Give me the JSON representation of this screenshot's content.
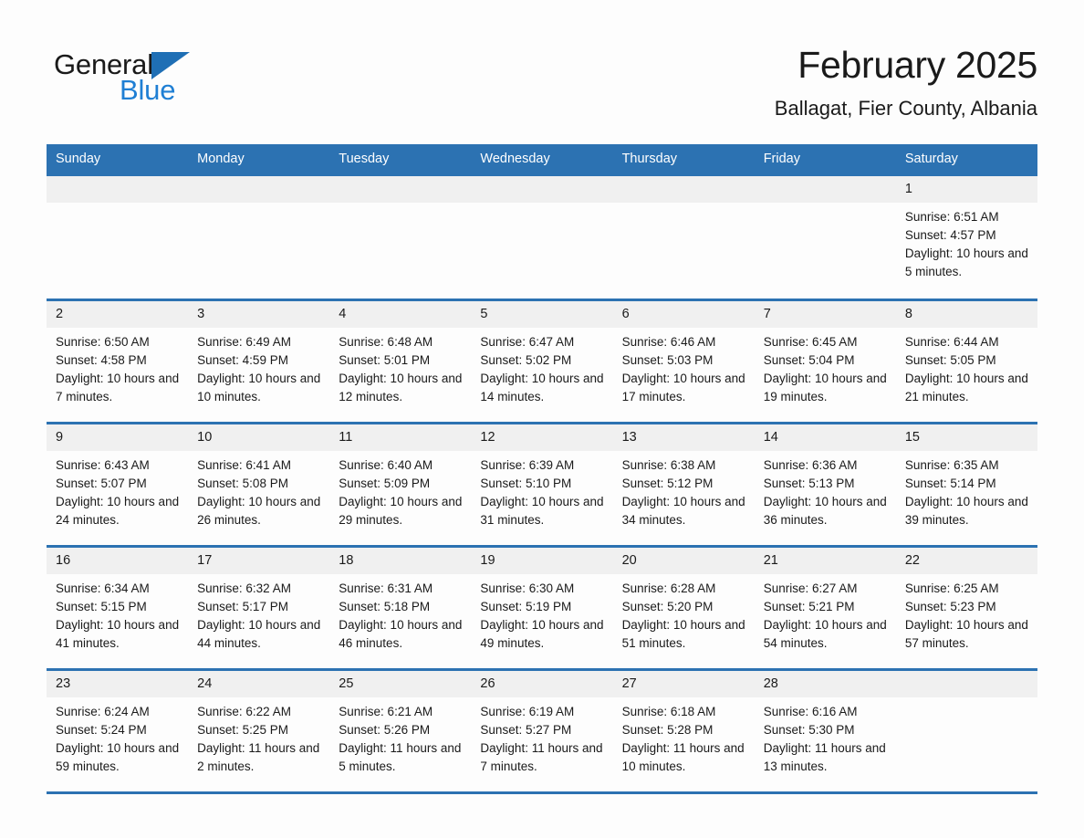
{
  "brand": {
    "name_part1": "General",
    "name_part2": "Blue",
    "triangle_color": "#1f6fb5",
    "blue_text_color": "#1f7fd4"
  },
  "header": {
    "month_title": "February 2025",
    "location": "Ballagat, Fier County, Albania"
  },
  "theme": {
    "header_blue": "#2c72b2",
    "daynum_band": "#f0f0f0",
    "page_background": "#fdfdfd",
    "text_color": "#1a1a1a"
  },
  "calendar": {
    "weekday_headers": [
      "Sunday",
      "Monday",
      "Tuesday",
      "Wednesday",
      "Thursday",
      "Friday",
      "Saturday"
    ],
    "weeks": [
      [
        {
          "day": "",
          "sunrise": "",
          "sunset": "",
          "daylight": ""
        },
        {
          "day": "",
          "sunrise": "",
          "sunset": "",
          "daylight": ""
        },
        {
          "day": "",
          "sunrise": "",
          "sunset": "",
          "daylight": ""
        },
        {
          "day": "",
          "sunrise": "",
          "sunset": "",
          "daylight": ""
        },
        {
          "day": "",
          "sunrise": "",
          "sunset": "",
          "daylight": ""
        },
        {
          "day": "",
          "sunrise": "",
          "sunset": "",
          "daylight": ""
        },
        {
          "day": "1",
          "sunrise": "Sunrise: 6:51 AM",
          "sunset": "Sunset: 4:57 PM",
          "daylight": "Daylight: 10 hours and 5 minutes."
        }
      ],
      [
        {
          "day": "2",
          "sunrise": "Sunrise: 6:50 AM",
          "sunset": "Sunset: 4:58 PM",
          "daylight": "Daylight: 10 hours and 7 minutes."
        },
        {
          "day": "3",
          "sunrise": "Sunrise: 6:49 AM",
          "sunset": "Sunset: 4:59 PM",
          "daylight": "Daylight: 10 hours and 10 minutes."
        },
        {
          "day": "4",
          "sunrise": "Sunrise: 6:48 AM",
          "sunset": "Sunset: 5:01 PM",
          "daylight": "Daylight: 10 hours and 12 minutes."
        },
        {
          "day": "5",
          "sunrise": "Sunrise: 6:47 AM",
          "sunset": "Sunset: 5:02 PM",
          "daylight": "Daylight: 10 hours and 14 minutes."
        },
        {
          "day": "6",
          "sunrise": "Sunrise: 6:46 AM",
          "sunset": "Sunset: 5:03 PM",
          "daylight": "Daylight: 10 hours and 17 minutes."
        },
        {
          "day": "7",
          "sunrise": "Sunrise: 6:45 AM",
          "sunset": "Sunset: 5:04 PM",
          "daylight": "Daylight: 10 hours and 19 minutes."
        },
        {
          "day": "8",
          "sunrise": "Sunrise: 6:44 AM",
          "sunset": "Sunset: 5:05 PM",
          "daylight": "Daylight: 10 hours and 21 minutes."
        }
      ],
      [
        {
          "day": "9",
          "sunrise": "Sunrise: 6:43 AM",
          "sunset": "Sunset: 5:07 PM",
          "daylight": "Daylight: 10 hours and 24 minutes."
        },
        {
          "day": "10",
          "sunrise": "Sunrise: 6:41 AM",
          "sunset": "Sunset: 5:08 PM",
          "daylight": "Daylight: 10 hours and 26 minutes."
        },
        {
          "day": "11",
          "sunrise": "Sunrise: 6:40 AM",
          "sunset": "Sunset: 5:09 PM",
          "daylight": "Daylight: 10 hours and 29 minutes."
        },
        {
          "day": "12",
          "sunrise": "Sunrise: 6:39 AM",
          "sunset": "Sunset: 5:10 PM",
          "daylight": "Daylight: 10 hours and 31 minutes."
        },
        {
          "day": "13",
          "sunrise": "Sunrise: 6:38 AM",
          "sunset": "Sunset: 5:12 PM",
          "daylight": "Daylight: 10 hours and 34 minutes."
        },
        {
          "day": "14",
          "sunrise": "Sunrise: 6:36 AM",
          "sunset": "Sunset: 5:13 PM",
          "daylight": "Daylight: 10 hours and 36 minutes."
        },
        {
          "day": "15",
          "sunrise": "Sunrise: 6:35 AM",
          "sunset": "Sunset: 5:14 PM",
          "daylight": "Daylight: 10 hours and 39 minutes."
        }
      ],
      [
        {
          "day": "16",
          "sunrise": "Sunrise: 6:34 AM",
          "sunset": "Sunset: 5:15 PM",
          "daylight": "Daylight: 10 hours and 41 minutes."
        },
        {
          "day": "17",
          "sunrise": "Sunrise: 6:32 AM",
          "sunset": "Sunset: 5:17 PM",
          "daylight": "Daylight: 10 hours and 44 minutes."
        },
        {
          "day": "18",
          "sunrise": "Sunrise: 6:31 AM",
          "sunset": "Sunset: 5:18 PM",
          "daylight": "Daylight: 10 hours and 46 minutes."
        },
        {
          "day": "19",
          "sunrise": "Sunrise: 6:30 AM",
          "sunset": "Sunset: 5:19 PM",
          "daylight": "Daylight: 10 hours and 49 minutes."
        },
        {
          "day": "20",
          "sunrise": "Sunrise: 6:28 AM",
          "sunset": "Sunset: 5:20 PM",
          "daylight": "Daylight: 10 hours and 51 minutes."
        },
        {
          "day": "21",
          "sunrise": "Sunrise: 6:27 AM",
          "sunset": "Sunset: 5:21 PM",
          "daylight": "Daylight: 10 hours and 54 minutes."
        },
        {
          "day": "22",
          "sunrise": "Sunrise: 6:25 AM",
          "sunset": "Sunset: 5:23 PM",
          "daylight": "Daylight: 10 hours and 57 minutes."
        }
      ],
      [
        {
          "day": "23",
          "sunrise": "Sunrise: 6:24 AM",
          "sunset": "Sunset: 5:24 PM",
          "daylight": "Daylight: 10 hours and 59 minutes."
        },
        {
          "day": "24",
          "sunrise": "Sunrise: 6:22 AM",
          "sunset": "Sunset: 5:25 PM",
          "daylight": "Daylight: 11 hours and 2 minutes."
        },
        {
          "day": "25",
          "sunrise": "Sunrise: 6:21 AM",
          "sunset": "Sunset: 5:26 PM",
          "daylight": "Daylight: 11 hours and 5 minutes."
        },
        {
          "day": "26",
          "sunrise": "Sunrise: 6:19 AM",
          "sunset": "Sunset: 5:27 PM",
          "daylight": "Daylight: 11 hours and 7 minutes."
        },
        {
          "day": "27",
          "sunrise": "Sunrise: 6:18 AM",
          "sunset": "Sunset: 5:28 PM",
          "daylight": "Daylight: 11 hours and 10 minutes."
        },
        {
          "day": "28",
          "sunrise": "Sunrise: 6:16 AM",
          "sunset": "Sunset: 5:30 PM",
          "daylight": "Daylight: 11 hours and 13 minutes."
        },
        {
          "day": "",
          "sunrise": "",
          "sunset": "",
          "daylight": ""
        }
      ]
    ]
  }
}
